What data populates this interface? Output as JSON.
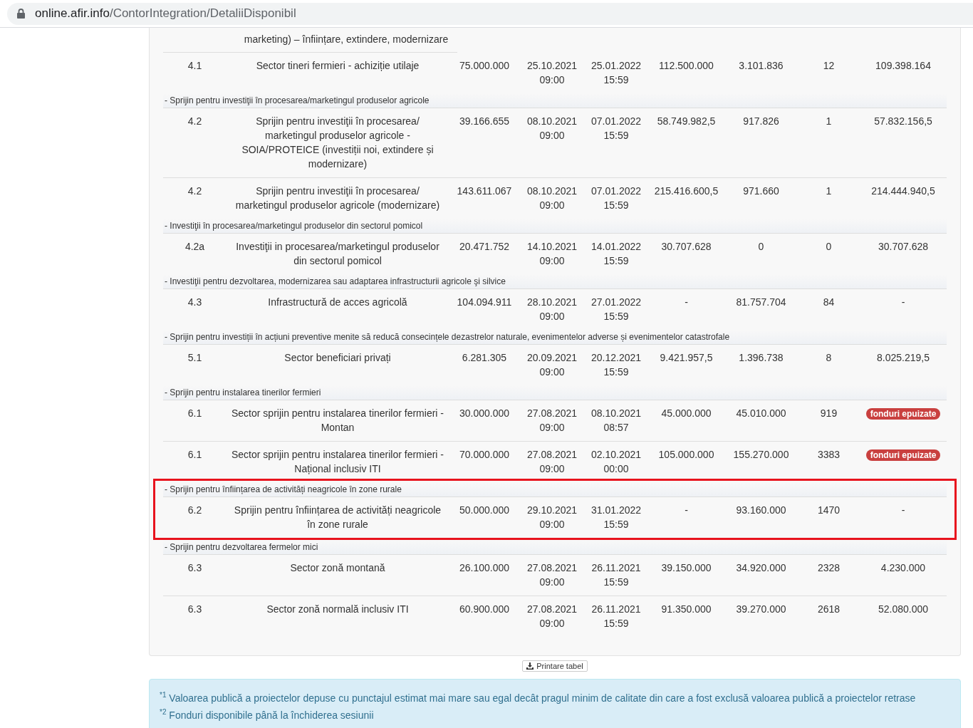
{
  "address_bar": {
    "host": "online.afir.info",
    "path": "/ContorIntegration/DetaliiDisponibil"
  },
  "partial_row": {
    "text": "marketing) – înființare, extindere, modernizare"
  },
  "groups": [
    {
      "highlighted": false,
      "rows": [
        {
          "kind": "text",
          "cells": [
            "4.1",
            "Sector tineri fermieri - achiziție utilaje",
            "75.000.000",
            "25.10.2021 09:00",
            "25.01.2022 15:59",
            "112.500.000",
            "3.101.836",
            "12",
            "109.398.164"
          ]
        }
      ]
    },
    {
      "title": "- Sprijin pentru investiţii în procesarea/marketingul produselor agricole",
      "highlighted": false,
      "rows": [
        {
          "kind": "text",
          "cells": [
            "4.2",
            "Sprijin pentru investiţii în procesarea/ marketingul produselor agricole - SOIA/PROTEICE (investiții noi, extindere și modernizare)",
            "39.166.655",
            "08.10.2021 09:00",
            "07.01.2022 15:59",
            "58.749.982,5",
            "917.826",
            "1",
            "57.832.156,5"
          ]
        },
        {
          "kind": "text",
          "cells": [
            "4.2",
            "Sprijin pentru investiţii în procesarea/ marketingul produselor agricole (modernizare)",
            "143.611.067",
            "08.10.2021 09:00",
            "07.01.2022 15:59",
            "215.416.600,5",
            "971.660",
            "1",
            "214.444.940,5"
          ]
        }
      ]
    },
    {
      "title": "- Investiţii în procesarea/marketingul produselor din sectorul pomicol",
      "highlighted": false,
      "rows": [
        {
          "kind": "text",
          "cells": [
            "4.2a",
            "Investiţii in procesarea/marketingul produselor din sectorul pomicol",
            "20.471.752",
            "14.10.2021 09:00",
            "14.01.2022 15:59",
            "30.707.628",
            "0",
            "0",
            "30.707.628"
          ]
        }
      ]
    },
    {
      "title": "- Investiţii pentru dezvoltarea, modernizarea sau adaptarea infrastructurii agricole şi silvice",
      "highlighted": false,
      "rows": [
        {
          "kind": "text",
          "cells": [
            "4.3",
            "Infrastructură de acces agricolă",
            "104.094.911",
            "28.10.2021 09:00",
            "27.01.2022 15:59",
            "-",
            "81.757.704",
            "84",
            "-"
          ]
        }
      ]
    },
    {
      "title": "- Sprijin pentru investiții în acțiuni preventive menite să reducă consecințele dezastrelor naturale, evenimentelor adverse și evenimentelor catastrofale",
      "highlighted": false,
      "rows": [
        {
          "kind": "text",
          "cells": [
            "5.1",
            "Sector beneficiari privați",
            "6.281.305",
            "20.09.2021 09:00",
            "20.12.2021 15:59",
            "9.421.957,5",
            "1.396.738",
            "8",
            "8.025.219,5"
          ]
        }
      ]
    },
    {
      "title": "- Sprijin pentru instalarea tinerilor fermieri",
      "highlighted": false,
      "rows": [
        {
          "kind": "badge",
          "cells": [
            "6.1",
            "Sector sprijin pentru instalarea tinerilor fermieri - Montan",
            "30.000.000",
            "27.08.2021 09:00",
            "08.10.2021 08:57",
            "45.000.000",
            "45.010.000",
            "919",
            "fonduri epuizate"
          ]
        },
        {
          "kind": "badge",
          "cells": [
            "6.1",
            "Sector sprijin pentru instalarea tinerilor fermieri - Național inclusiv ITI",
            "70.000.000",
            "27.08.2021 09:00",
            "02.10.2021 00:00",
            "105.000.000",
            "155.270.000",
            "3383",
            "fonduri epuizate"
          ]
        }
      ]
    },
    {
      "title": "- Sprijin pentru înființarea de activități neagricole în zone rurale",
      "highlighted": true,
      "rows": [
        {
          "kind": "text",
          "cells": [
            "6.2",
            "Sprijin pentru înființarea de activități neagricole în zone rurale",
            "50.000.000",
            "29.10.2021 09:00",
            "31.01.2022 15:59",
            "-",
            "93.160.000",
            "1470",
            "-"
          ]
        }
      ]
    },
    {
      "title": "- Sprijin pentru dezvoltarea fermelor mici",
      "highlighted": false,
      "rows": [
        {
          "kind": "text",
          "cells": [
            "6.3",
            "Sector zonă montană",
            "26.100.000",
            "27.08.2021 09:00",
            "26.11.2021 15:59",
            "39.150.000",
            "34.920.000",
            "2328",
            "4.230.000"
          ]
        },
        {
          "kind": "text",
          "cells": [
            "6.3",
            "Sector zonă normală inclusiv ITI",
            "60.900.000",
            "27.08.2021 09:00",
            "26.11.2021 15:59",
            "91.350.000",
            "39.270.000",
            "2618",
            "52.080.000"
          ]
        }
      ]
    }
  ],
  "print_button": {
    "label": "Printare tabel"
  },
  "footnotes": [
    "$^{*1}$ Valoarea publică a proiectelor depuse cu punctajul estimat mai mare sau egal decât pragul minim de calitate din care a fost exclusă valoarea publică a proiectelor retrase",
    "$^{*2}$ Fonduri disponibile până la închiderea sesiunii"
  ]
}
